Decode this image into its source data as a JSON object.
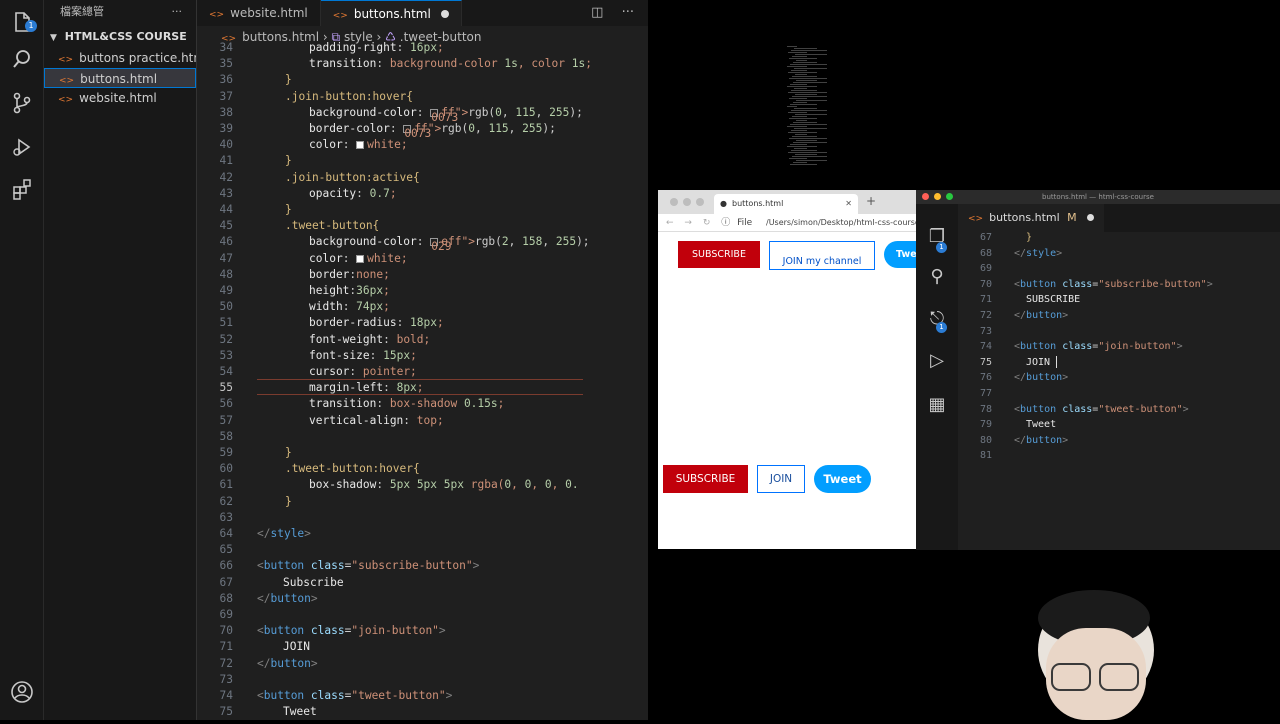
{
  "explorer": {
    "header": "檔案總管",
    "more": "···",
    "folder": "HTML&CSS COURSE",
    "files": [
      {
        "label": "buttons practice.html",
        "active": false
      },
      {
        "label": "buttons.html",
        "active": true
      },
      {
        "label": "website.html",
        "active": false
      }
    ]
  },
  "activity_icons": [
    "files-icon",
    "search-icon",
    "source-control-icon",
    "run-debug-icon",
    "extensions-icon",
    "account-icon"
  ],
  "activity_badge": "1",
  "editor": {
    "tabs": [
      {
        "label": "website.html",
        "active": false,
        "dirty": false
      },
      {
        "label": "buttons.html",
        "active": true,
        "dirty": true
      }
    ],
    "breadcrumb": {
      "file": "buttons.html",
      "style": "style",
      "selector": ".tweet-button"
    },
    "active_line": "55",
    "lines": [
      {
        "n": "34",
        "t": "padding-right: 16px;"
      },
      {
        "n": "35",
        "t": "transition: background-color 1s, color 1s;"
      },
      {
        "n": "36",
        "t": "}"
      },
      {
        "n": "37",
        "t": ".join-button:hover{"
      },
      {
        "n": "38",
        "t": "background-color: rgb(0, 115, 255);"
      },
      {
        "n": "39",
        "t": "border-color: rgb(0, 115, 255);"
      },
      {
        "n": "40",
        "t": "color: white;"
      },
      {
        "n": "41",
        "t": "}"
      },
      {
        "n": "42",
        "t": ".join-button:active{"
      },
      {
        "n": "43",
        "t": "opacity: 0.7;"
      },
      {
        "n": "44",
        "t": "}"
      },
      {
        "n": "45",
        "t": ".tweet-button{"
      },
      {
        "n": "46",
        "t": "background-color: rgb(2, 158, 255);"
      },
      {
        "n": "47",
        "t": "color: white;"
      },
      {
        "n": "48",
        "t": "border:none;"
      },
      {
        "n": "49",
        "t": "height:36px;"
      },
      {
        "n": "50",
        "t": "width: 74px;"
      },
      {
        "n": "51",
        "t": "border-radius: 18px;"
      },
      {
        "n": "52",
        "t": "font-weight: bold;"
      },
      {
        "n": "53",
        "t": "font-size: 15px;"
      },
      {
        "n": "54",
        "t": "cursor: pointer;"
      },
      {
        "n": "55",
        "t": "margin-left: 8px;"
      },
      {
        "n": "56",
        "t": "transition: box-shadow 0.15s;"
      },
      {
        "n": "57",
        "t": "vertical-align: top;"
      },
      {
        "n": "58",
        "t": ""
      },
      {
        "n": "59",
        "t": "}"
      },
      {
        "n": "60",
        "t": ".tweet-button:hover{"
      },
      {
        "n": "61",
        "t": "box-shadow: 5px 5px 5px rgba(0, 0, 0, 0."
      },
      {
        "n": "62",
        "t": "}"
      },
      {
        "n": "63",
        "t": ""
      },
      {
        "n": "64",
        "t": "</style>"
      },
      {
        "n": "65",
        "t": ""
      },
      {
        "n": "66",
        "t": "<button class=\"subscribe-button\">"
      },
      {
        "n": "67",
        "t": "Subscribe"
      },
      {
        "n": "68",
        "t": "</button>"
      },
      {
        "n": "69",
        "t": ""
      },
      {
        "n": "70",
        "t": "<button class=\"join-button\">"
      },
      {
        "n": "71",
        "t": "JOIN"
      },
      {
        "n": "72",
        "t": "</button>"
      },
      {
        "n": "73",
        "t": ""
      },
      {
        "n": "74",
        "t": "<button class=\"tweet-button\">"
      },
      {
        "n": "75",
        "t": "Tweet"
      }
    ]
  },
  "browser": {
    "tab_title": "buttons.html",
    "url_prefix": "File",
    "url": "/Users/simon/Desktop/html-css-course",
    "buttons": {
      "subscribe": "SUBSCRIBE",
      "join": "JOIN my channel",
      "tweet": "Twe"
    }
  },
  "result": {
    "subscribe": "SUBSCRIBE",
    "join": "JOIN",
    "tweet": "Tweet"
  },
  "right_editor": {
    "window_title": "buttons.html — html-css-course",
    "tab": "buttons.html",
    "tab_status": "M",
    "badge": "1",
    "lines": [
      {
        "n": "67",
        "t": "}"
      },
      {
        "n": "68",
        "t": "</style>"
      },
      {
        "n": "69",
        "t": ""
      },
      {
        "n": "70",
        "t": "<button class=\"subscribe-button\">"
      },
      {
        "n": "71",
        "t": "SUBSCRIBE"
      },
      {
        "n": "72",
        "t": "</button>"
      },
      {
        "n": "73",
        "t": ""
      },
      {
        "n": "74",
        "t": "<button class=\"join-button\">"
      },
      {
        "n": "75",
        "t": "JOIN "
      },
      {
        "n": "76",
        "t": "</button>"
      },
      {
        "n": "77",
        "t": ""
      },
      {
        "n": "78",
        "t": "<button class=\"tweet-button\">"
      },
      {
        "n": "79",
        "t": "Tweet"
      },
      {
        "n": "80",
        "t": "</button>"
      },
      {
        "n": "81",
        "t": ""
      }
    ]
  },
  "colors": {
    "subscribe_red": "#c1000b",
    "tweet_blue": "#029eff",
    "join_border": "#0073ff",
    "accent": "#0078d4"
  }
}
